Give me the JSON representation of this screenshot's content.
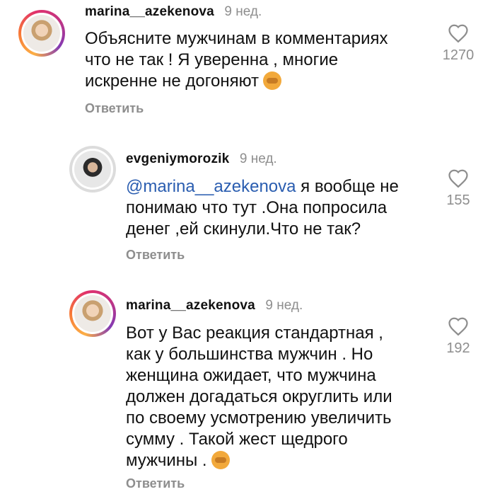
{
  "comments": [
    {
      "username": "marina__azekenova",
      "time": "9 нед.",
      "mention": "",
      "lines": [
        "Объясните мужчинам в комментариях",
        "что не так ! Я уверенна , многие",
        "искренне не догоняют"
      ],
      "reply": "Ответить",
      "likes": "1270",
      "emoji": "see-no-evil-monkey-emoji"
    },
    {
      "username": "evgeniymorozik",
      "time": "9 нед.",
      "mention": "@marina__azekenova",
      "lines": [
        " я вообще не",
        "понимаю что тут .Она попросила",
        "денег ,ей скинули.Что не так?"
      ],
      "reply": "Ответить",
      "likes": "155"
    },
    {
      "username": "marina__azekenova",
      "time": "9 нед.",
      "mention": "",
      "lines": [
        "Вот у Вас реакция стандартная ,",
        "как у большинства мужчин . Но",
        "женщина ожидает, что мужчина",
        "должен догадаться округлить или",
        "по своему усмотрению увеличить",
        "сумму . Такой жест щедрого",
        "мужчины ."
      ],
      "reply": "Ответить",
      "likes": "192",
      "emoji": "see-no-evil-monkey-emoji"
    }
  ],
  "colors": {
    "text": "#111111",
    "muted": "#8e8e8e",
    "mention": "#2a5db0",
    "ring": "#e1306c"
  },
  "icons": {
    "like": "heart-outline-icon"
  }
}
